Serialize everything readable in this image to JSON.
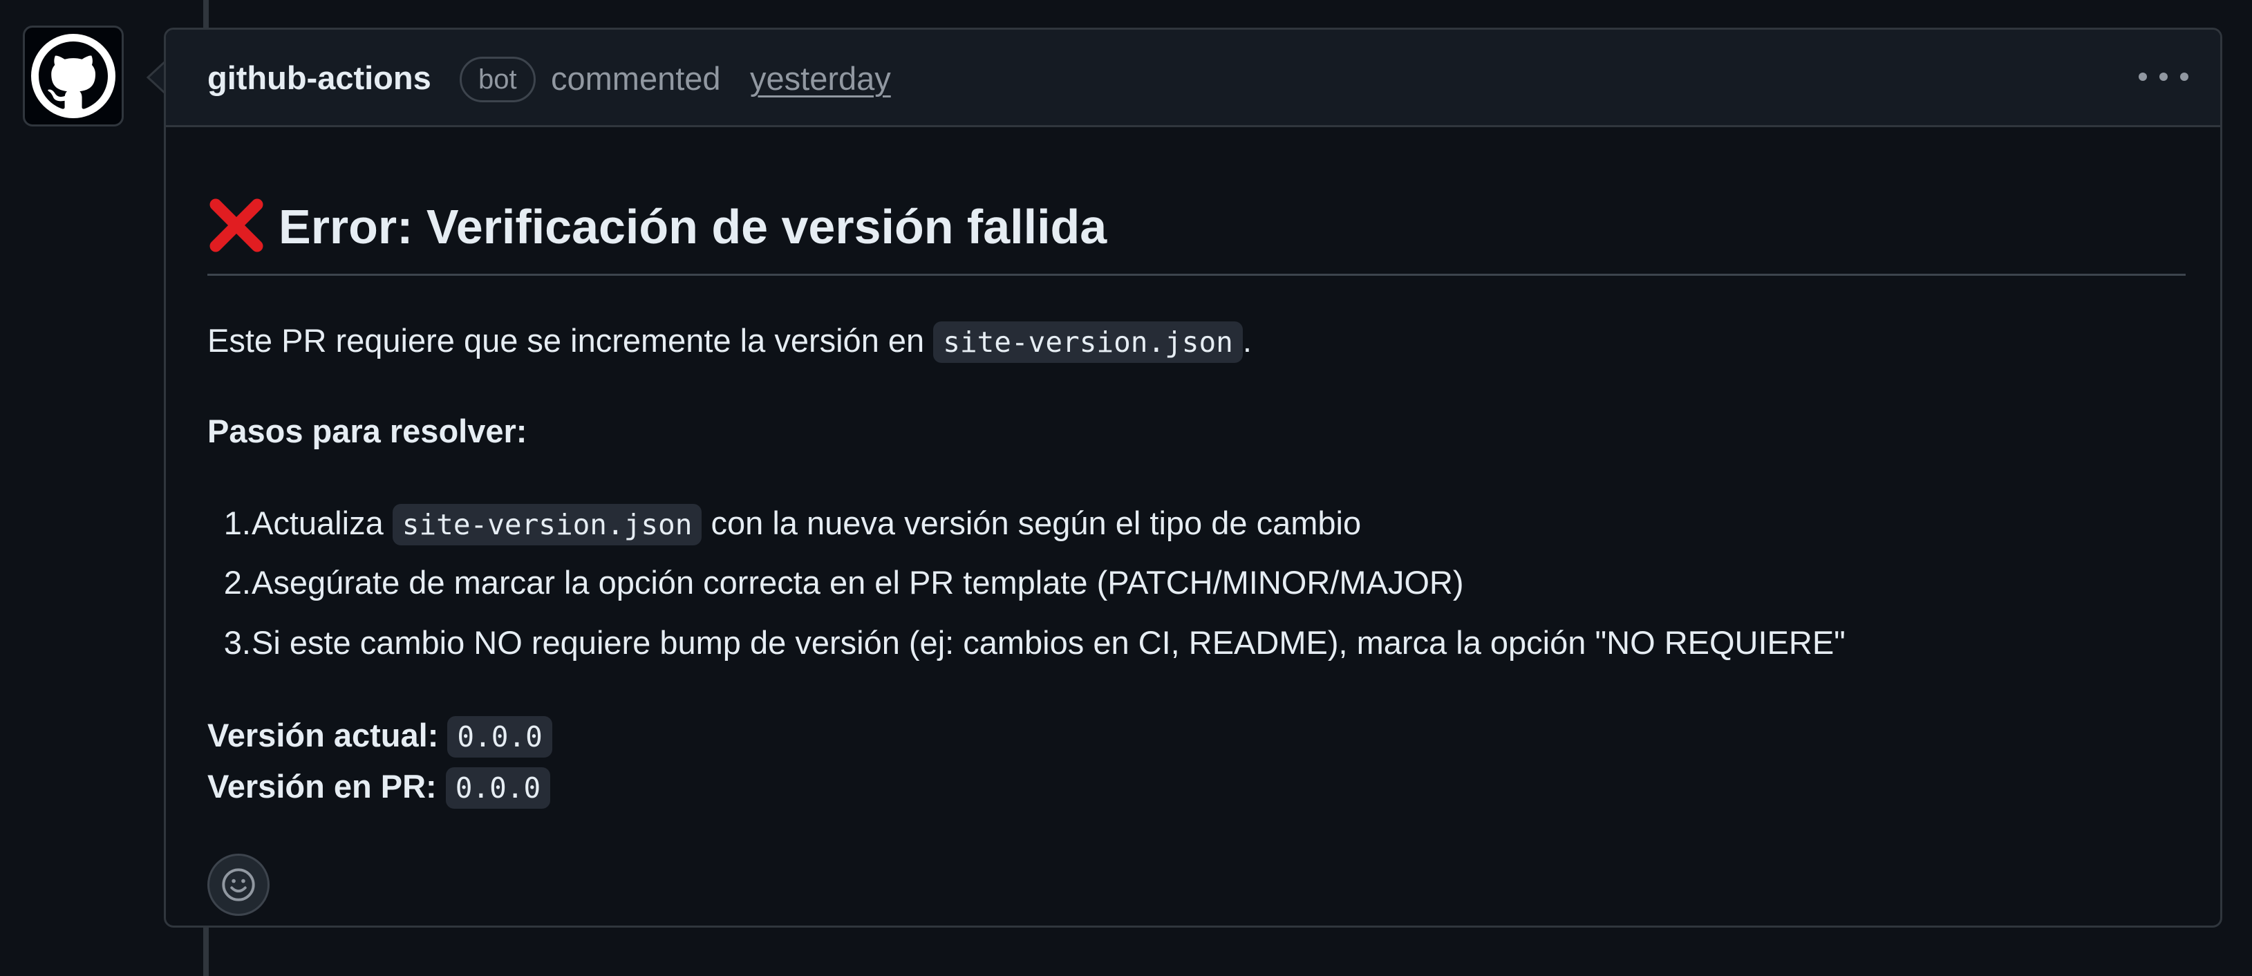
{
  "comment": {
    "author": "github-actions",
    "badge": "bot",
    "action": "commented",
    "timestamp": "yesterday",
    "title_icon": "cross-mark-icon",
    "title": "Error: Verificación de versión fallida",
    "intro_text": "Este PR requiere que se incremente la versión en",
    "intro_code": "site-version.json",
    "intro_end": ".",
    "steps_heading": "Pasos para resolver:",
    "steps": [
      {
        "num": "1.",
        "before": "Actualiza",
        "code": "site-version.json",
        "after": "con la nueva versión según el tipo de cambio"
      },
      {
        "num": "2.",
        "text": "Asegúrate de marcar la opción correcta en el PR template (PATCH/MINOR/MAJOR)"
      },
      {
        "num": "3.",
        "text": "Si este cambio NO requiere bump de versión (ej: cambios en CI, README), marca la opción \"NO REQUIERE\""
      }
    ],
    "current_version_label": "Versión actual:",
    "current_version_value": "0.0.0",
    "pr_version_label": "Versión en PR:",
    "pr_version_value": "0.0.0"
  },
  "icons": {
    "avatar": "github-octocat-icon",
    "more": "kebab-horizontal-icon",
    "reaction": "smiley-icon"
  },
  "colors": {
    "background": "#0d1117",
    "header_bg": "#151b23",
    "border": "#30363d",
    "text": "#e6edf3",
    "muted": "#9198a1",
    "error_red": "#e11d21"
  }
}
